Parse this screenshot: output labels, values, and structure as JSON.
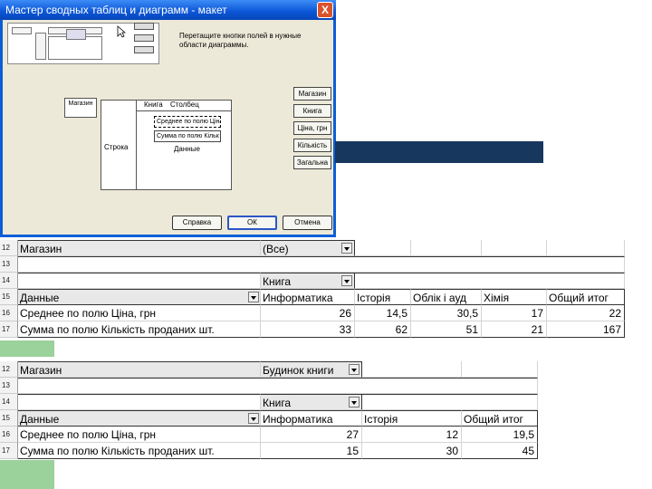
{
  "dialog": {
    "title": "Мастер сводных таблиц и диаграмм - макет",
    "close_label": "X",
    "instruction": "Перетащите кнопки полей в нужные области диаграммы.",
    "page_area_label": "Магазин",
    "row_area_label": "Строка",
    "column_area_label": "Столбец",
    "column_field": "Книга",
    "data_area_label": "Данные",
    "data_fields": [
      "Среднее по полю Ціна",
      "Сумма по полю Кільк"
    ],
    "field_buttons": [
      "Магазин",
      "Книга",
      "Ціна, грн",
      "Кількість",
      "Загальна"
    ],
    "buttons": {
      "help": "Справка",
      "ok": "ОК",
      "cancel": "Отмена"
    }
  },
  "colors": {
    "titlebar": "#0a55d6",
    "navy_bar": "#17375e",
    "green_block": "#9bd19b"
  },
  "sheet1": {
    "row_numbers": [
      "12",
      "13",
      "14",
      "15",
      "16",
      "17"
    ],
    "page_label": "Магазин",
    "page_value": "(Все)",
    "col_field": "Книга",
    "data_header": "Данные",
    "columns": [
      "Информатика",
      "Історія",
      "Облік і ауд",
      "Хімія",
      "Общий итог"
    ],
    "rows": [
      {
        "label": "Среднее по полю Ціна, грн",
        "values": [
          "26",
          "14,5",
          "30,5",
          "17",
          "22"
        ]
      },
      {
        "label": "Сумма по полю Кількість проданих шт.",
        "values": [
          "33",
          "62",
          "51",
          "21",
          "167"
        ]
      }
    ]
  },
  "sheet2": {
    "row_numbers": [
      "12",
      "13",
      "14",
      "15",
      "16",
      "17"
    ],
    "page_label": "Магазин",
    "page_value": "Будинок книги",
    "col_field": "Книга",
    "data_header": "Данные",
    "columns": [
      "Информатика",
      "Історія",
      "Общий итог"
    ],
    "rows": [
      {
        "label": "Среднее по полю Ціна, грн",
        "values": [
          "27",
          "12",
          "19,5"
        ]
      },
      {
        "label": "Сумма по полю Кількість проданих шт.",
        "values": [
          "15",
          "30",
          "45"
        ]
      }
    ]
  }
}
